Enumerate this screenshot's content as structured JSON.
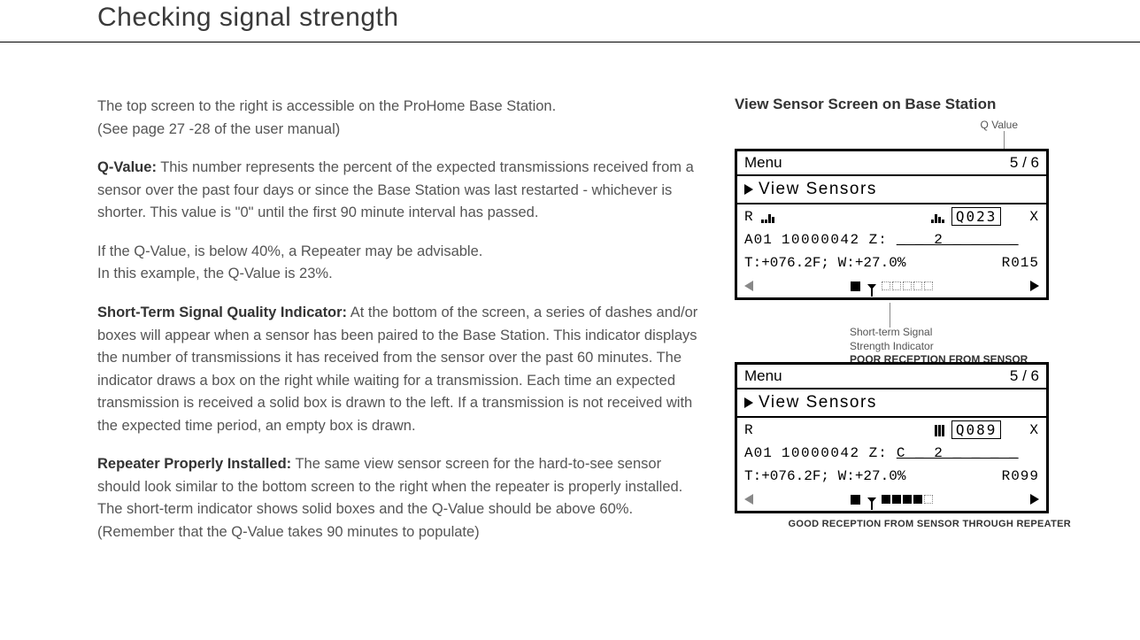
{
  "title": "Checking signal strength",
  "paras": {
    "intro1": "The top screen to the right is accessible on the ProHome Base Station.",
    "intro2": "(See page 27 -28 of the user manual)",
    "q_head": "Q-Value:",
    "q_body": " This number represents the percent of the expected transmissions received from a sensor over the past four days or since the Base Station was last restarted - whichever is shorter.  This value is \"0\" until the first 90 minute interval has passed.",
    "q2a": "If the Q-Value, is below 40%, a Repeater may be advisable.",
    "q2b": "In this example, the Q-Value is 23%.",
    "s_head": "Short-Term Signal Quality Indicator:",
    "s_body": " At the bottom of the screen, a series of dashes and/or boxes will appear when a sensor has been paired to the Base Station. This indicator displays the number of transmissions it has received from the sensor over the past 60 minutes. The indicator draws a box on the right while waiting for a transmission. Each time an expected transmission is received a solid box is drawn to the left. If a transmission is not received with the expected time period, an empty box is drawn.",
    "r_head": "Repeater Properly Installed:",
    "r_body": " The same view sensor screen for the hard-to-see sensor should look similar to the bottom screen to the right when the repeater is properly installed.  The short-term indicator shows solid boxes and the Q-Value should be above 60%. (Remember that the Q-Value takes 90 minutes to populate)"
  },
  "right": {
    "title": "View Sensor Screen on Base Station",
    "q_callout": "Q Value",
    "short_callout1": "Short-term Signal",
    "short_callout2": "Strength Indicator",
    "caption_poor": "POOR RECEPTION FROM SENSOR",
    "caption_good": "GOOD RECEPTION FROM SENSOR THROUGH REPEATER"
  },
  "lcd": {
    "menu": "Menu",
    "page": "5 / 6",
    "view": "View Sensors",
    "r": "R",
    "x": "X",
    "a01": "A01",
    "serial": "10000042",
    "z_label": "Z:",
    "z1": "_ _ 2 _ _ _ _",
    "z2": "C _ 2 _ _ _ _",
    "tw1": "T:+076.2F; W:+27.0%",
    "r1": "R015",
    "q1": "Q023",
    "tw2": "T:+076.2F; W:+27.0%",
    "r2": "R099",
    "q2": "Q089"
  }
}
